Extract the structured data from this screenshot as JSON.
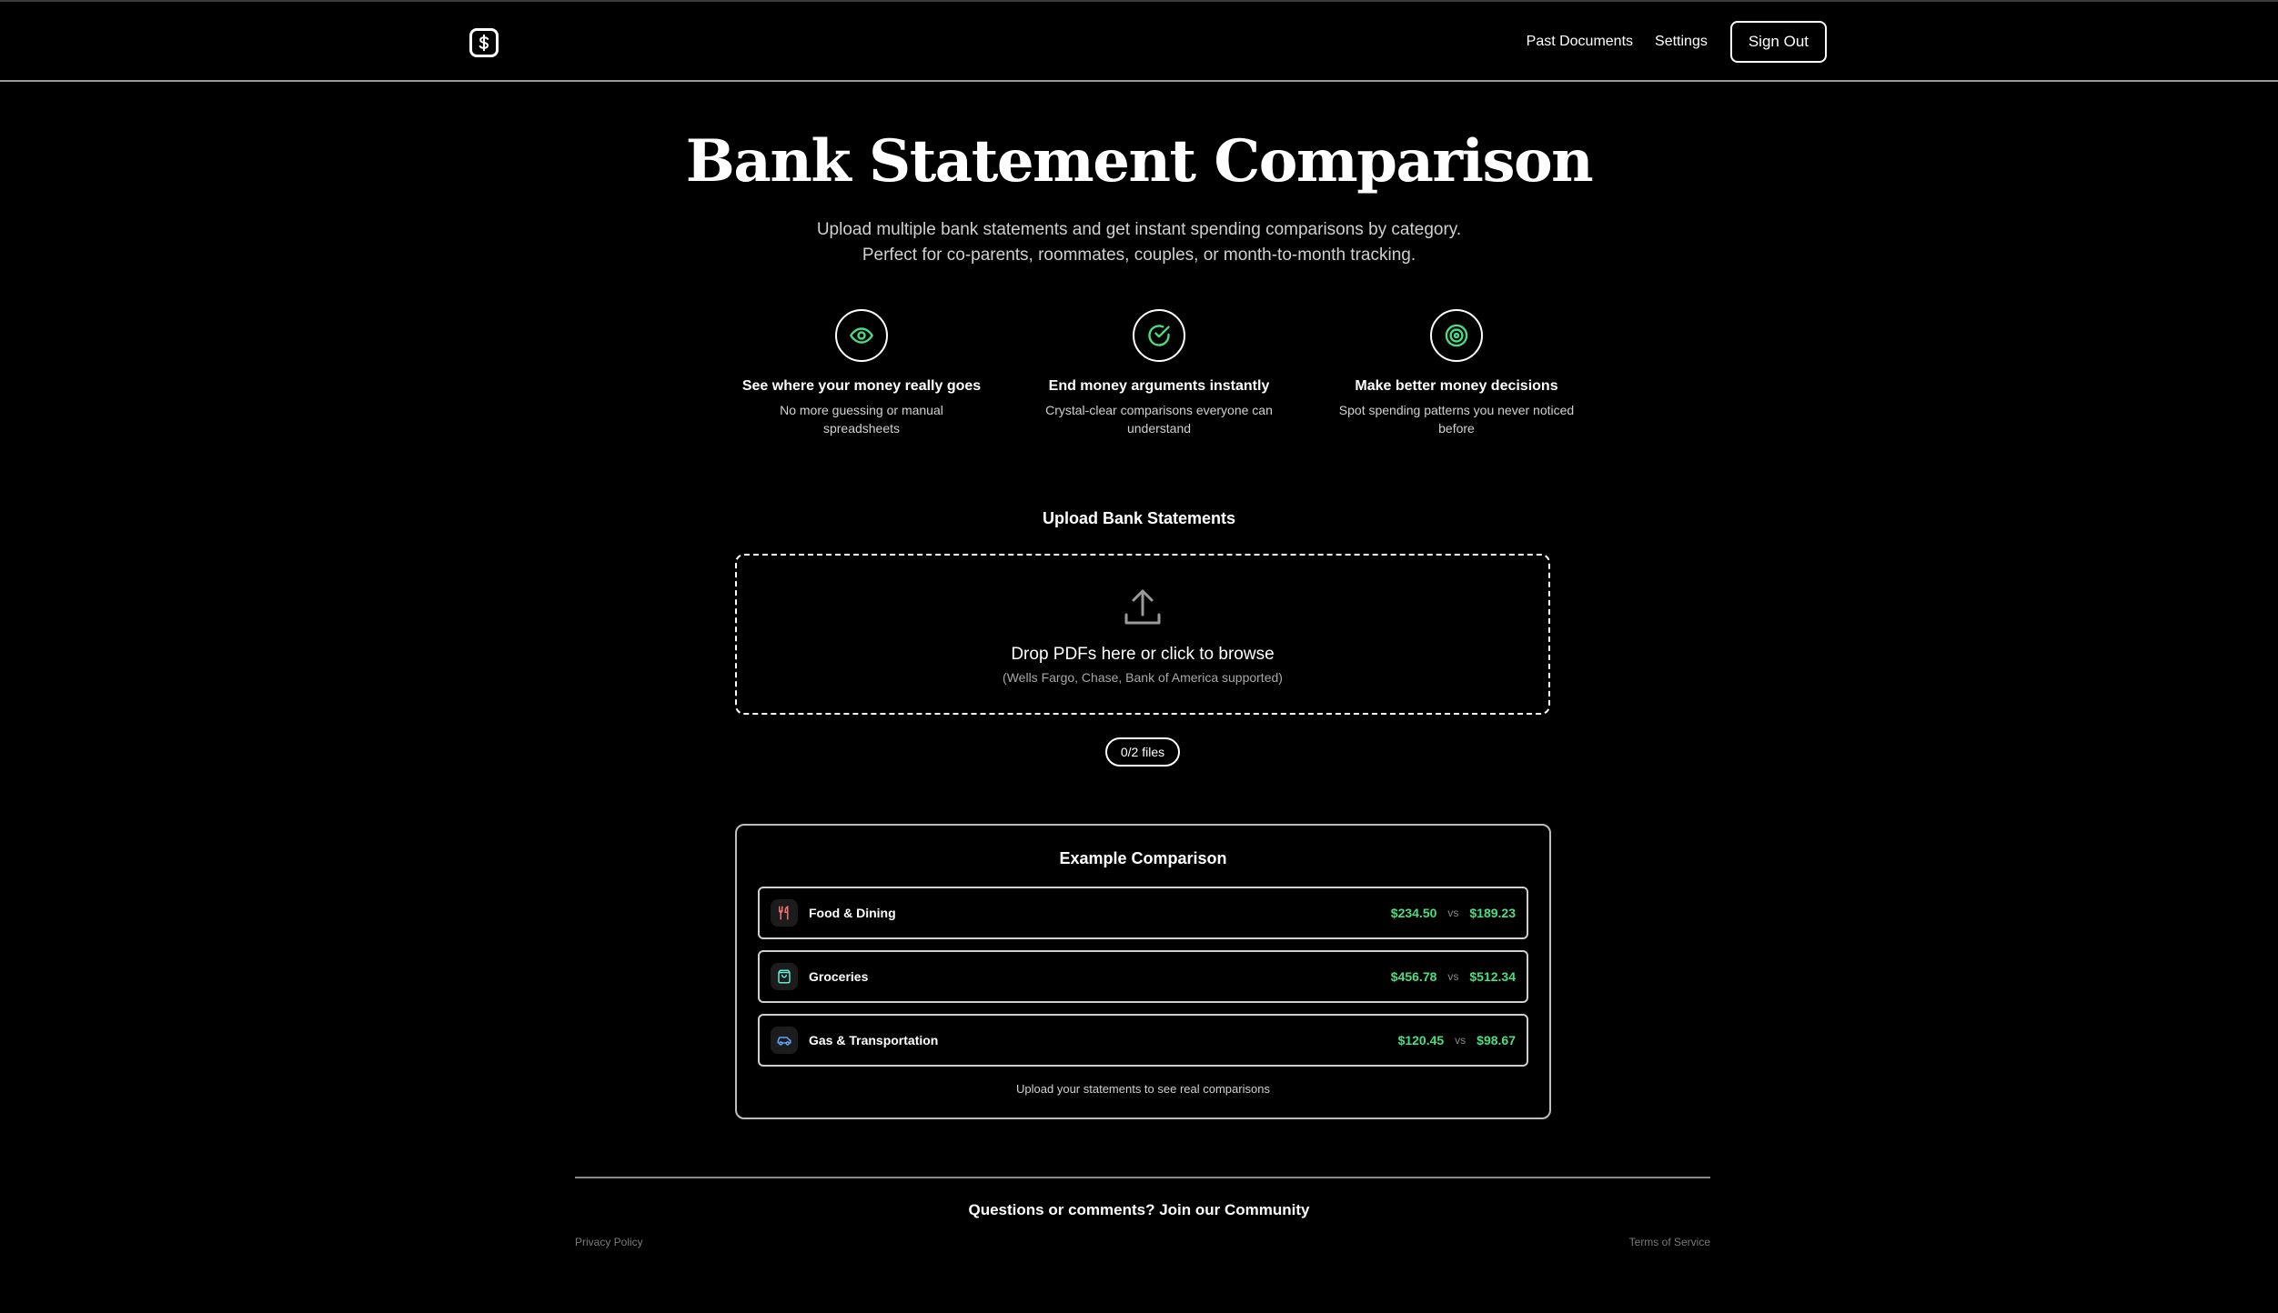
{
  "header": {
    "logo_icon": "dollar-icon",
    "nav": [
      {
        "label": "Past Documents"
      },
      {
        "label": "Settings"
      }
    ],
    "sign_out_label": "Sign Out"
  },
  "hero": {
    "title": "Bank Statement Comparison",
    "subtitle_line1": "Upload multiple bank statements and get instant spending comparisons by category.",
    "subtitle_line2": "Perfect for co-parents, roommates, couples, or month-to-month tracking."
  },
  "features": [
    {
      "icon": "eye-icon",
      "title": "See where your money really goes",
      "desc_line1": "No more guessing or manual",
      "desc_line2": "spreadsheets"
    },
    {
      "icon": "check-circle-icon",
      "title": "End money arguments instantly",
      "desc_line1": "Crystal-clear comparisons everyone can",
      "desc_line2": "understand"
    },
    {
      "icon": "target-icon",
      "title": "Make better money decisions",
      "desc_line1": "Spot spending patterns you never noticed",
      "desc_line2": "before"
    }
  ],
  "upload": {
    "heading": "Upload Bank Statements",
    "drop_text": "Drop PDFs here or click to browse",
    "drop_hint": "(Wells Fargo, Chase, Bank of America supported)",
    "file_count": "0/2 files"
  },
  "example": {
    "title": "Example Comparison",
    "rows": [
      {
        "icon": "utensils-icon",
        "label": "Food & Dining",
        "a": "$234.50",
        "vs": "vs",
        "b": "$189.23"
      },
      {
        "icon": "shopping-bag-icon",
        "label": "Groceries",
        "a": "$456.78",
        "vs": "vs",
        "b": "$512.34"
      },
      {
        "icon": "car-icon",
        "label": "Gas & Transportation",
        "a": "$120.45",
        "vs": "vs",
        "b": "$98.67"
      }
    ],
    "note": "Upload your statements to see real comparisons"
  },
  "footer": {
    "cta": "Questions or comments? Join our Community",
    "privacy": "Privacy Policy",
    "terms": "Terms of Service"
  },
  "colors": {
    "background": "#000000",
    "accent_green": "#4ade80",
    "icon_red": "#f87171",
    "icon_teal": "#5eead4",
    "icon_blue": "#60a5fa"
  }
}
